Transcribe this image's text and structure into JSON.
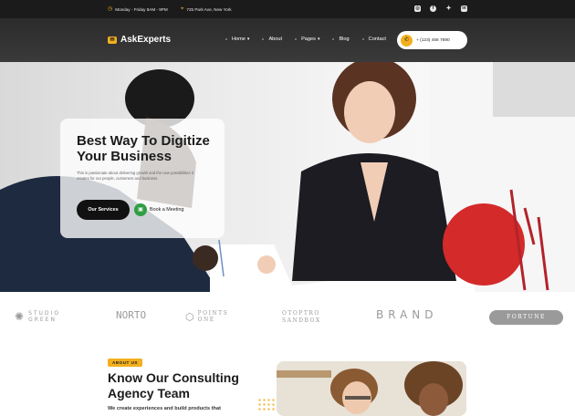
{
  "topbar": {
    "hours": "Monday - Friday 8AM - 9PM",
    "address": "725 Park Ave, New York",
    "socials": [
      "instagram-icon",
      "facebook-icon",
      "twitter-icon",
      "linkedin-icon"
    ]
  },
  "header": {
    "logo": "AskExperts",
    "nav": [
      {
        "label": "Home",
        "dropdown": true
      },
      {
        "label": "About",
        "dropdown": false
      },
      {
        "label": "Pages",
        "dropdown": true
      },
      {
        "label": "Blog",
        "dropdown": false
      },
      {
        "label": "Contact",
        "dropdown": false
      }
    ],
    "phone": "+ (123) 456 7890"
  },
  "hero": {
    "title": "Best Way To Digitize Your Business",
    "text": "This is passionate about delivering growth and the new possibilities it creates for our people, customers and business.",
    "primary_button": "Our Services",
    "secondary_button": "Book a Meeting"
  },
  "brands": [
    "STUDIO GREEN",
    "NORTO",
    "POINTS ONE",
    "OTOPTRO SANDBOX",
    "BRAND",
    "FORTUNE"
  ],
  "about": {
    "badge": "ABOUT US",
    "title": "Know Our Consulting Agency Team",
    "text": "We create experiences and build products that"
  },
  "colors": {
    "accent": "#f2b01e",
    "dark": "#1b1b1b",
    "topbar": "#1b1b1b",
    "nav": "#2f2f2f",
    "meeting": "#2f9e44"
  }
}
